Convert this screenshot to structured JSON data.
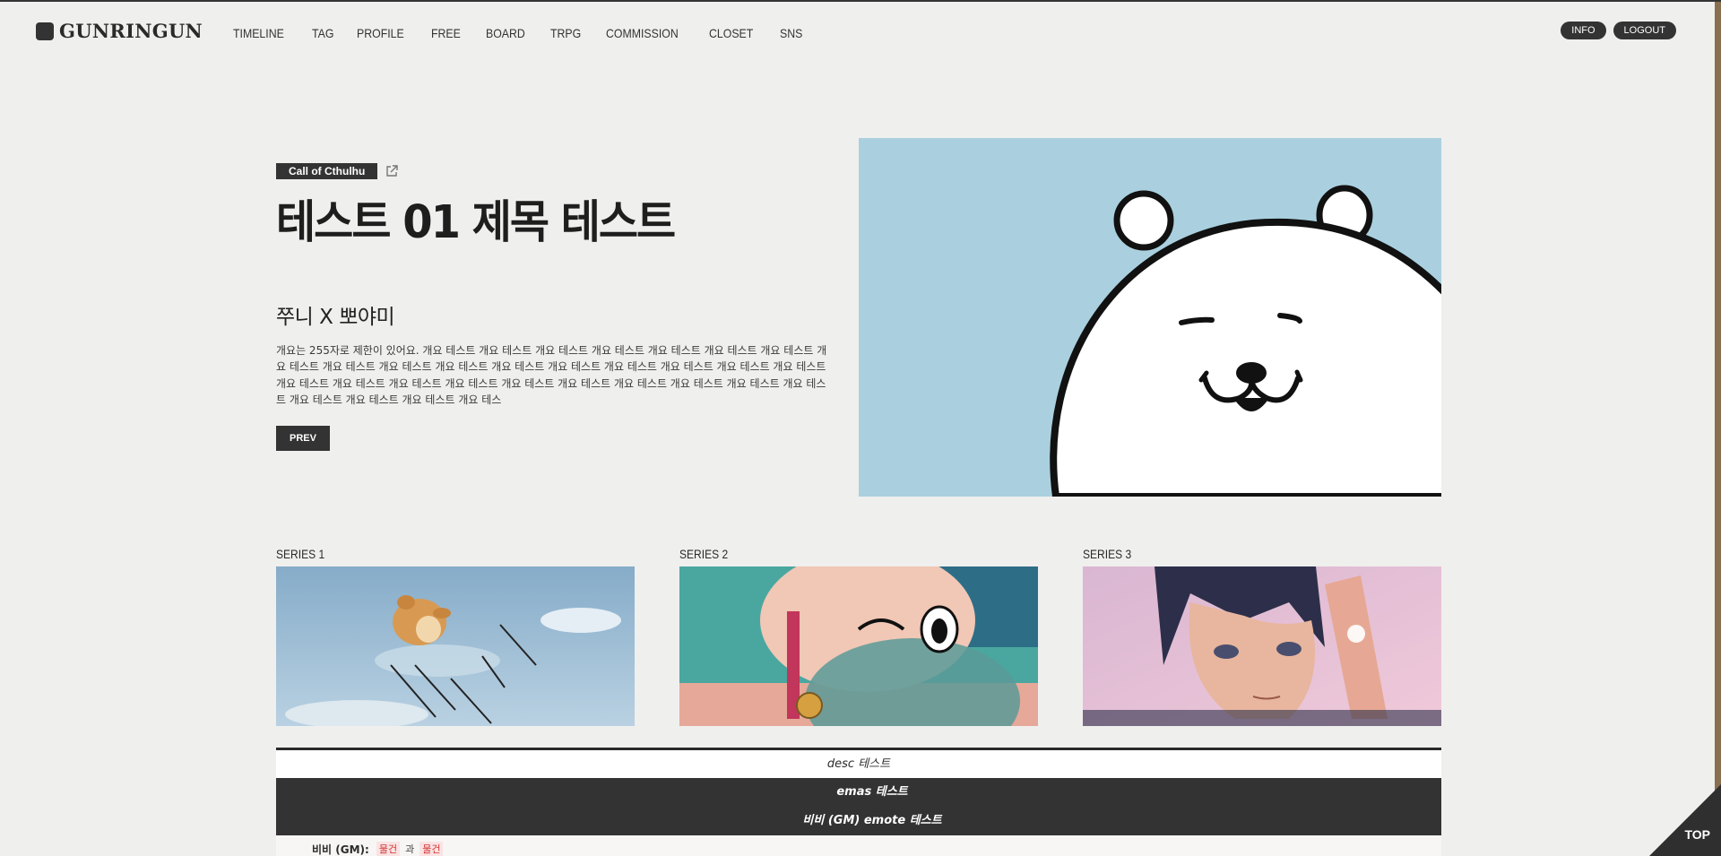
{
  "brand": {
    "name": "GUNRINGUN"
  },
  "nav": [
    "TIMELINE",
    "TAG",
    "PROFILE",
    "FREE",
    "BOARD",
    "TRPG",
    "COMMISSION",
    "CLOSET",
    "SNS"
  ],
  "top_right": {
    "info": "INFO",
    "logout": "LOGOUT"
  },
  "hero": {
    "tag": "Call of Cthulhu",
    "title": "테스트 01 제목 테스트",
    "subtitle": "쭈니 X 뽀야미",
    "description": "개요는 255자로 제한이 있어요. 개요 테스트 개요 테스트 개요 테스트 개요 테스트 개요 테스트 개요 테스트 개요 테스트 개요 테스트 개요 테스트 개요 테스트 개요 테스트 개요 테스트 개요 테스트 개요 테스트 개요 테스트 개요 테스트 개요 테스트 개요 테스트 개요 테스트 개요 테스트 개요 테스트 개요 테스트 개요 테스트 개요 테스트 개요 테스트 개요 테스트 개요 테스트 개요 테스트 개요 테스트 개요 테스트 개요 테스",
    "prev_label": "PREV"
  },
  "series": [
    {
      "label": "SERIES 1"
    },
    {
      "label": "SERIES 2"
    },
    {
      "label": "SERIES 3"
    }
  ],
  "info": {
    "desc": "desc 테스트",
    "emas": "emas 테스트",
    "emote": "비비 (GM) emote 테스트",
    "emote_row": {
      "name": "비비 (GM):",
      "keyword1": "물건",
      "and": "과",
      "keyword2": "물건"
    }
  },
  "top_label": "TOP",
  "colors": {
    "dark": "#333333",
    "background": "#efefee",
    "hero_bg": "#aad0df"
  }
}
